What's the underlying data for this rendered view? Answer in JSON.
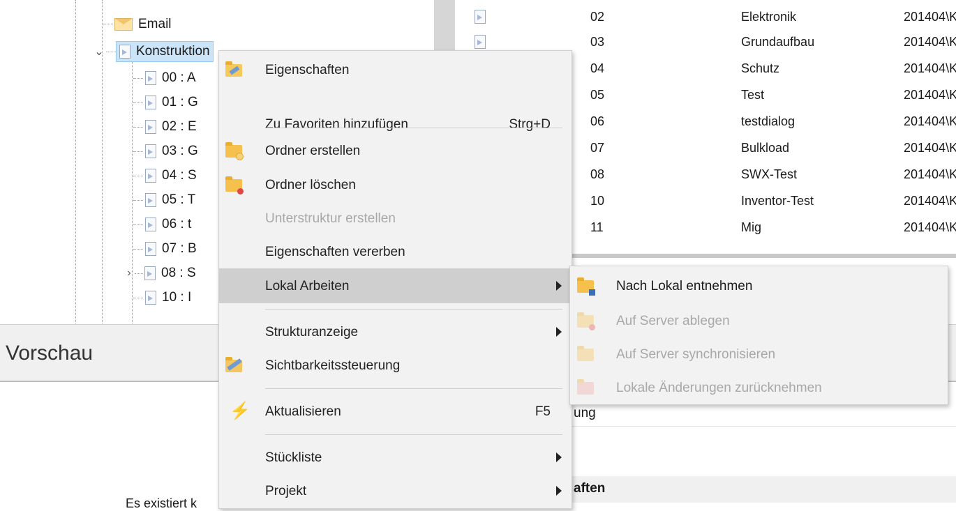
{
  "tree": {
    "items": [
      {
        "label": "Email"
      },
      {
        "label": "Konstruktion"
      },
      {
        "label": "00 : A"
      },
      {
        "label": "01 : G"
      },
      {
        "label": "02 : E"
      },
      {
        "label": "03 : G"
      },
      {
        "label": "04 : S"
      },
      {
        "label": "05 : T"
      },
      {
        "label": "06 : t"
      },
      {
        "label": "07 : B"
      },
      {
        "label": "08 : S"
      },
      {
        "label": "10 : I"
      }
    ]
  },
  "list": {
    "rows": [
      {
        "num": "02",
        "name": "Elektronik",
        "path": "201404\\K"
      },
      {
        "num": "03",
        "name": "Grundaufbau",
        "path": "201404\\K"
      },
      {
        "num": "04",
        "name": "Schutz",
        "path": "201404\\K"
      },
      {
        "num": "05",
        "name": "Test",
        "path": "201404\\K"
      },
      {
        "num": "06",
        "name": "testdialog",
        "path": "201404\\K"
      },
      {
        "num": "07",
        "name": "Bulkload",
        "path": "201404\\K"
      },
      {
        "num": "08",
        "name": "SWX-Test",
        "path": "201404\\K"
      },
      {
        "num": "10",
        "name": "Inventor-Test",
        "path": "201404\\K"
      },
      {
        "num": "11",
        "name": "Mig",
        "path": "201404\\K"
      }
    ]
  },
  "preview": {
    "title": "Vorschau",
    "fragment_ung": "ung",
    "fragment_aften": "aften",
    "fragment_bottom": "Es existiert k"
  },
  "context_menu": {
    "items": [
      {
        "label": "Eigenschaften"
      },
      {
        "label": "Zu Favoriten hinzufügen",
        "shortcut": "Strg+D"
      },
      {
        "label": "Ordner erstellen"
      },
      {
        "label": "Ordner löschen"
      },
      {
        "label": "Unterstruktur erstellen"
      },
      {
        "label": "Eigenschaften vererben"
      },
      {
        "label": "Lokal Arbeiten"
      },
      {
        "label": "Strukturanzeige"
      },
      {
        "label": "Sichtbarkeitssteuerung"
      },
      {
        "label": "Aktualisieren",
        "shortcut": "F5"
      },
      {
        "label": "Stückliste"
      },
      {
        "label": "Projekt"
      }
    ]
  },
  "submenu": {
    "items": [
      {
        "label": "Nach Lokal entnehmen"
      },
      {
        "label": "Auf Server ablegen"
      },
      {
        "label": "Auf Server synchronisieren"
      },
      {
        "label": "Lokale Änderungen zurücknehmen"
      }
    ]
  },
  "colors": {
    "menu_bg": "#f2f2f2",
    "menu_highlight": "#cfcfcf",
    "disabled_text": "#a8a8a8",
    "tree_selection": "#cce4f7",
    "folder": "#f5c04b"
  },
  "icons": {
    "email": "mail-icon",
    "document": "document-icon",
    "properties": "properties-icon",
    "folder_create": "folder-create-icon",
    "folder_delete": "folder-delete-icon",
    "visibility": "visibility-icon",
    "refresh": "lightning-icon",
    "submenu_arrow": "chevron-right-icon"
  }
}
